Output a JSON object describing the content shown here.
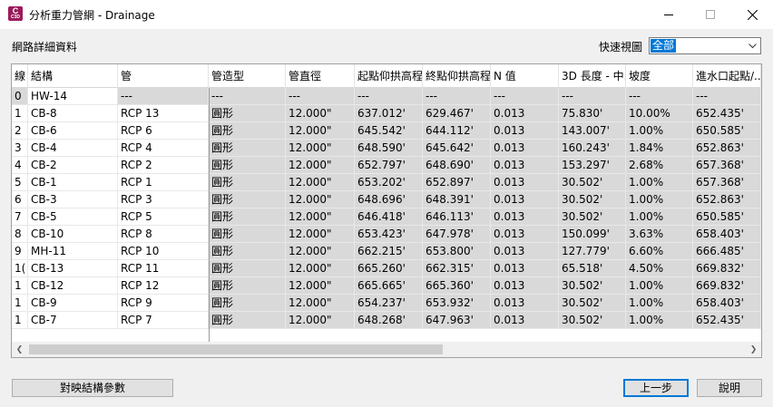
{
  "window": {
    "title": "分析重力管網 - Drainage",
    "icon_letter": "C",
    "icon_sub": "C3D"
  },
  "section_label": "網路詳細資料",
  "quick_view": {
    "label": "快速視圖",
    "selected": "全部"
  },
  "columns": [
    "線",
    "結構",
    "管",
    "管造型",
    "管直徑",
    "起點仰拱高程",
    "終點仰拱高程",
    "N 值",
    "3D 長度 - 中...",
    "坡度",
    "進水口起點/..."
  ],
  "rows": [
    [
      "0",
      "HW-14",
      "---",
      "---",
      "---",
      "---",
      "---",
      "---",
      "---",
      "---",
      "---"
    ],
    [
      "1",
      "CB-8",
      "RCP 13",
      "圓形",
      "12.000\"",
      "637.012'",
      "629.467'",
      "0.013",
      "75.830'",
      "10.00%",
      "652.435'"
    ],
    [
      "2",
      "CB-6",
      "RCP 6",
      "圓形",
      "12.000\"",
      "645.542'",
      "644.112'",
      "0.013",
      "143.007'",
      "1.00%",
      "650.585'"
    ],
    [
      "3",
      "CB-4",
      "RCP 4",
      "圓形",
      "12.000\"",
      "648.590'",
      "645.642'",
      "0.013",
      "160.243'",
      "1.84%",
      "652.863'"
    ],
    [
      "4",
      "CB-2",
      "RCP 2",
      "圓形",
      "12.000\"",
      "652.797'",
      "648.690'",
      "0.013",
      "153.297'",
      "2.68%",
      "657.368'"
    ],
    [
      "5",
      "CB-1",
      "RCP 1",
      "圓形",
      "12.000\"",
      "653.202'",
      "652.897'",
      "0.013",
      "30.502'",
      "1.00%",
      "657.368'"
    ],
    [
      "6",
      "CB-3",
      "RCP 3",
      "圓形",
      "12.000\"",
      "648.696'",
      "648.391'",
      "0.013",
      "30.502'",
      "1.00%",
      "652.863'"
    ],
    [
      "7",
      "CB-5",
      "RCP 5",
      "圓形",
      "12.000\"",
      "646.418'",
      "646.113'",
      "0.013",
      "30.502'",
      "1.00%",
      "650.585'"
    ],
    [
      "8",
      "CB-10",
      "RCP 8",
      "圓形",
      "12.000\"",
      "653.423'",
      "647.978'",
      "0.013",
      "150.099'",
      "3.63%",
      "658.403'"
    ],
    [
      "9",
      "MH-11",
      "RCP 10",
      "圓形",
      "12.000\"",
      "662.215'",
      "653.800'",
      "0.013",
      "127.779'",
      "6.60%",
      "666.485'"
    ],
    [
      "1(",
      "CB-13",
      "RCP 11",
      "圓形",
      "12.000\"",
      "665.260'",
      "662.315'",
      "0.013",
      "65.518'",
      "4.50%",
      "669.832'"
    ],
    [
      "1",
      "CB-12",
      "RCP 12",
      "圓形",
      "12.000\"",
      "665.665'",
      "665.360'",
      "0.013",
      "30.502'",
      "1.00%",
      "669.832'"
    ],
    [
      "1",
      "CB-9",
      "RCP 9",
      "圓形",
      "12.000\"",
      "654.237'",
      "653.932'",
      "0.013",
      "30.502'",
      "1.00%",
      "658.403'"
    ],
    [
      "1",
      "CB-7",
      "RCP 7",
      "圓形",
      "12.000\"",
      "648.268'",
      "647.963'",
      "0.013",
      "30.502'",
      "1.00%",
      "652.435'"
    ]
  ],
  "buttons": {
    "map_params": "對映結構參數",
    "back": "上一步",
    "help": "說明"
  }
}
